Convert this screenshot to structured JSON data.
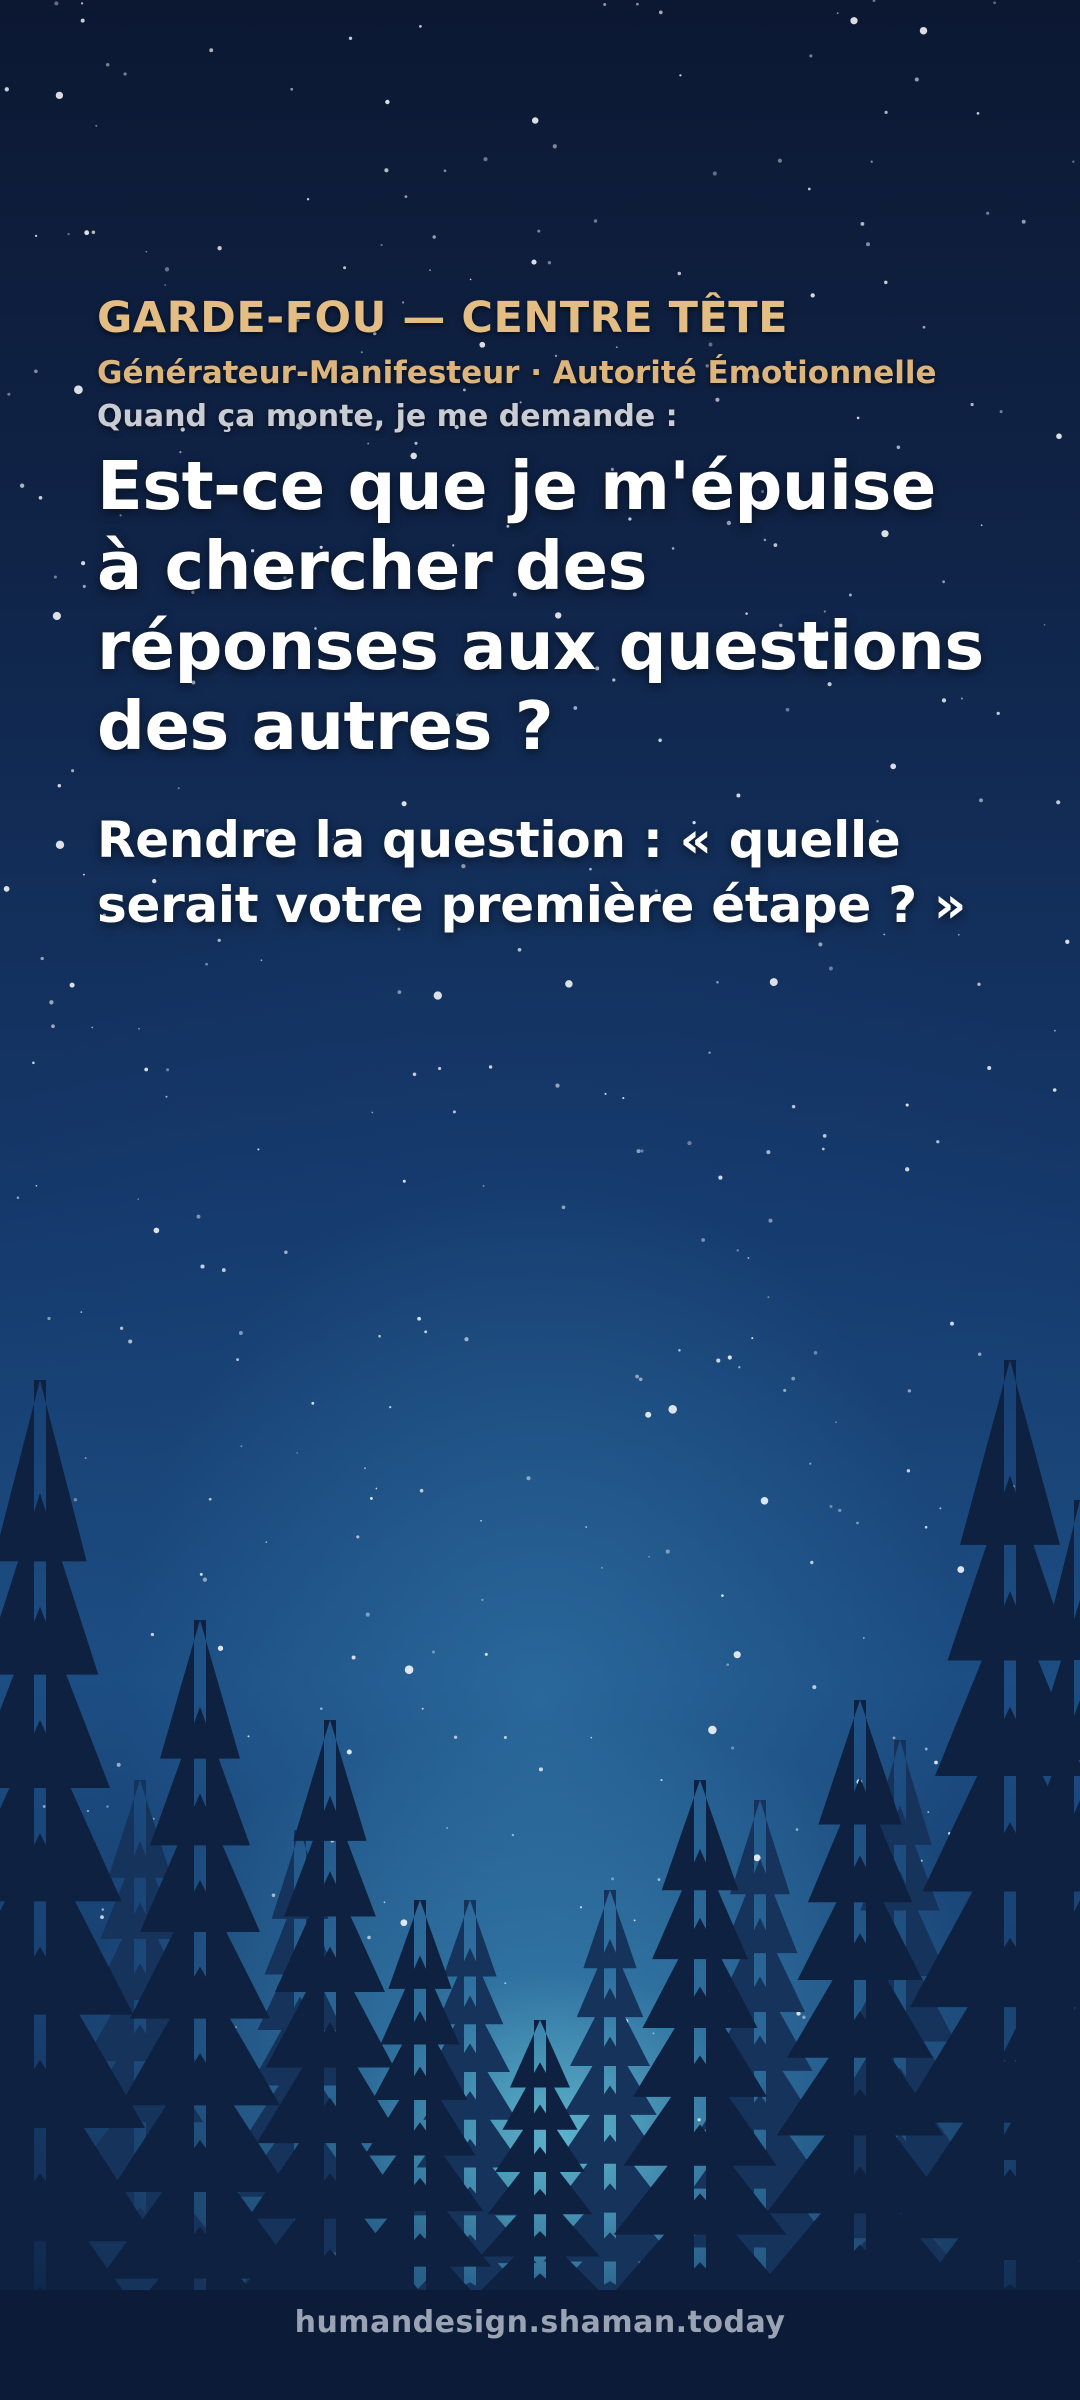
{
  "card": {
    "kicker": "GARDE-FOU — CENTRE TÊTE",
    "subtitle": "Générateur-Manifesteur · Autorité Émotionnelle",
    "prompt": "Quand ça monte, je me demande :",
    "question": "Est-ce que je m'épuise à chercher des réponses aux questions des autres ?",
    "answer": "Rendre la question : « quelle serait votre première étape ? »"
  },
  "footer": {
    "url": "humandesign.shaman.today"
  },
  "colors": {
    "accent_gold": "#e3bd83",
    "text_white": "#ffffff",
    "muted_gray": "#c9ccd2",
    "footer_gray": "#9aa3b4",
    "sky_top": "#0c1832",
    "horizon_glow": "#69c8dc",
    "tree_silhouette": "#0e2140"
  },
  "background": {
    "scene": "starry-night-sky-over-pine-forest"
  }
}
